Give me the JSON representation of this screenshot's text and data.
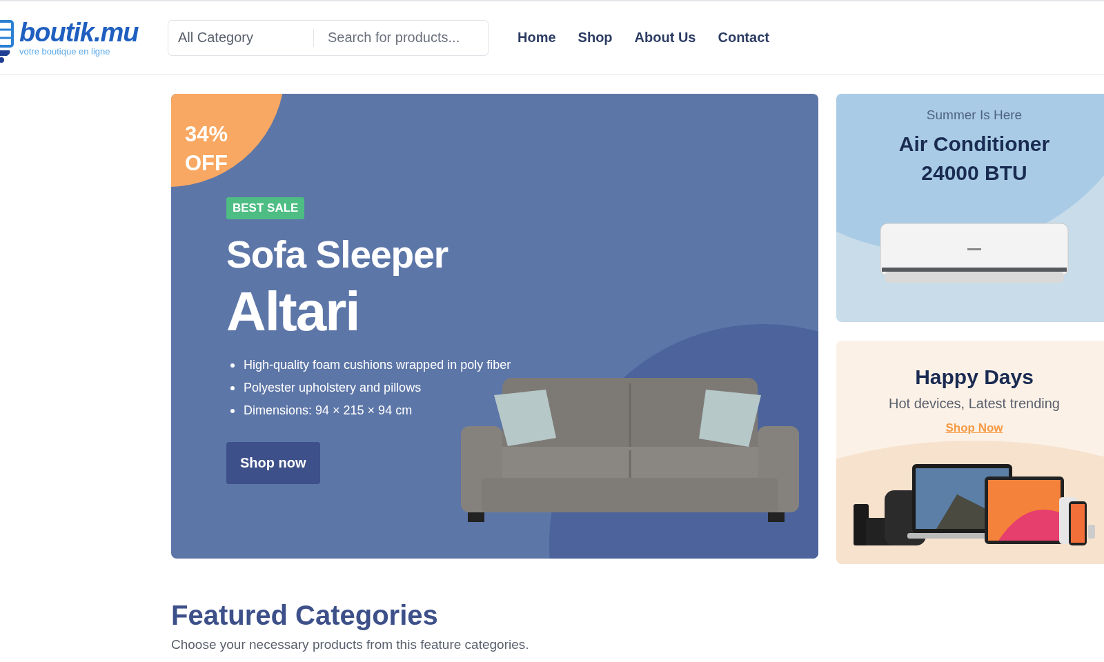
{
  "header": {
    "logo": {
      "name": "boutik.mu",
      "tagline": "votre boutique en ligne"
    },
    "search": {
      "category": "All Category",
      "placeholder": "Search for products..."
    },
    "nav": [
      {
        "label": "Home"
      },
      {
        "label": "Shop"
      },
      {
        "label": "About Us"
      },
      {
        "label": "Contact"
      }
    ]
  },
  "hero": {
    "discount_value": "34%",
    "discount_label": "OFF",
    "badge": "BEST SALE",
    "title": "Sofa Sleeper",
    "subtitle": "Altari",
    "features": [
      "High-quality foam cushions wrapped in poly fiber",
      "Polyester upholstery and pillows",
      "Dimensions: 94 × 215 × 94 cm"
    ],
    "button": "Shop now"
  },
  "side_cards": [
    {
      "kind": "product",
      "eyebrow": "Summer Is Here",
      "title": "Air Conditioner 24000 BTU"
    },
    {
      "kind": "promo",
      "title": "Happy Days",
      "subtitle": "Hot devices, Latest trending",
      "link": "Shop Now"
    }
  ],
  "featured": {
    "title": "Featured Categories",
    "subtitle": "Choose your necessary products from this feature categories."
  }
}
